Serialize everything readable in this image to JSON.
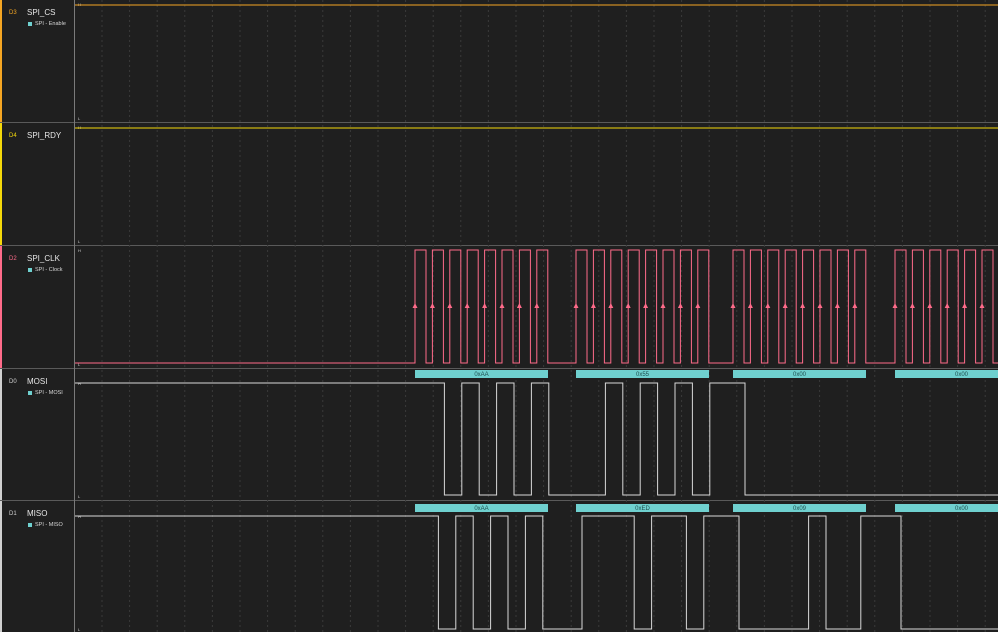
{
  "accent_colors": {
    "SPI_CS": "#f5a623",
    "SPI_RDY": "#f5d90a",
    "SPI_CLK": "#ff6b8a",
    "MOSI": "#d0d0d0",
    "MISO": "#d0d0d0",
    "decode": "#6fd0cf"
  },
  "level_labels": {
    "high": "H",
    "low": "L"
  },
  "channels": [
    {
      "id": "D3",
      "name": "SPI_CS",
      "analyzer": "SPI - Enable"
    },
    {
      "id": "D4",
      "name": "SPI_RDY",
      "analyzer": ""
    },
    {
      "id": "D2",
      "name": "SPI_CLK",
      "analyzer": "SPI - Clock"
    },
    {
      "id": "D0",
      "name": "MOSI",
      "analyzer": "SPI - MOSI"
    },
    {
      "id": "D1",
      "name": "MISO",
      "analyzer": "SPI - MISO"
    }
  ],
  "mosi_bytes": [
    "0xAA",
    "0x55",
    "0x00",
    "0x00"
  ],
  "miso_bytes": [
    "0xAA",
    "0xED",
    "0x09",
    "0x00"
  ]
}
